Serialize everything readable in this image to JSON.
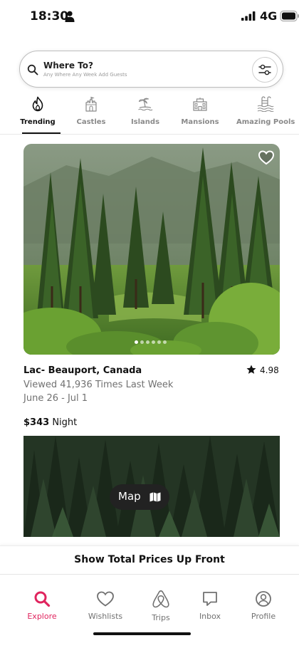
{
  "status_bar": {
    "time": "18:30",
    "network": "4G"
  },
  "search": {
    "title": "Where To?",
    "subtitle": "Any Where Any Week Add Guests"
  },
  "categories": [
    {
      "label": "Trending",
      "icon": "flame-icon",
      "active": true
    },
    {
      "label": "Castles",
      "icon": "castle-icon"
    },
    {
      "label": "Islands",
      "icon": "island-icon"
    },
    {
      "label": "Mansions",
      "icon": "mansion-icon"
    },
    {
      "label": "Amazing Pools",
      "icon": "pool-icon"
    }
  ],
  "listing": {
    "title": "Lac- Beauport, Canada",
    "rating": "4.98",
    "views": "Viewed 41,936 Times Last Week",
    "dates": "June 26 - Jul 1",
    "price": "$343",
    "price_unit": "Night",
    "photo_index": 1,
    "photo_count": 6
  },
  "map_button": {
    "label": "Map"
  },
  "banner": {
    "text": "Show Total Prices Up Front"
  },
  "tabbar": {
    "accent_color": "#e0245e",
    "items": [
      {
        "label": "Explore",
        "icon": "search-icon",
        "active": true
      },
      {
        "label": "Wishlists",
        "icon": "heart-icon"
      },
      {
        "label": "Trips",
        "icon": "airbnb-logo-icon"
      },
      {
        "label": "Inbox",
        "icon": "chat-icon"
      },
      {
        "label": "Profile",
        "icon": "user-circle-icon"
      }
    ]
  }
}
